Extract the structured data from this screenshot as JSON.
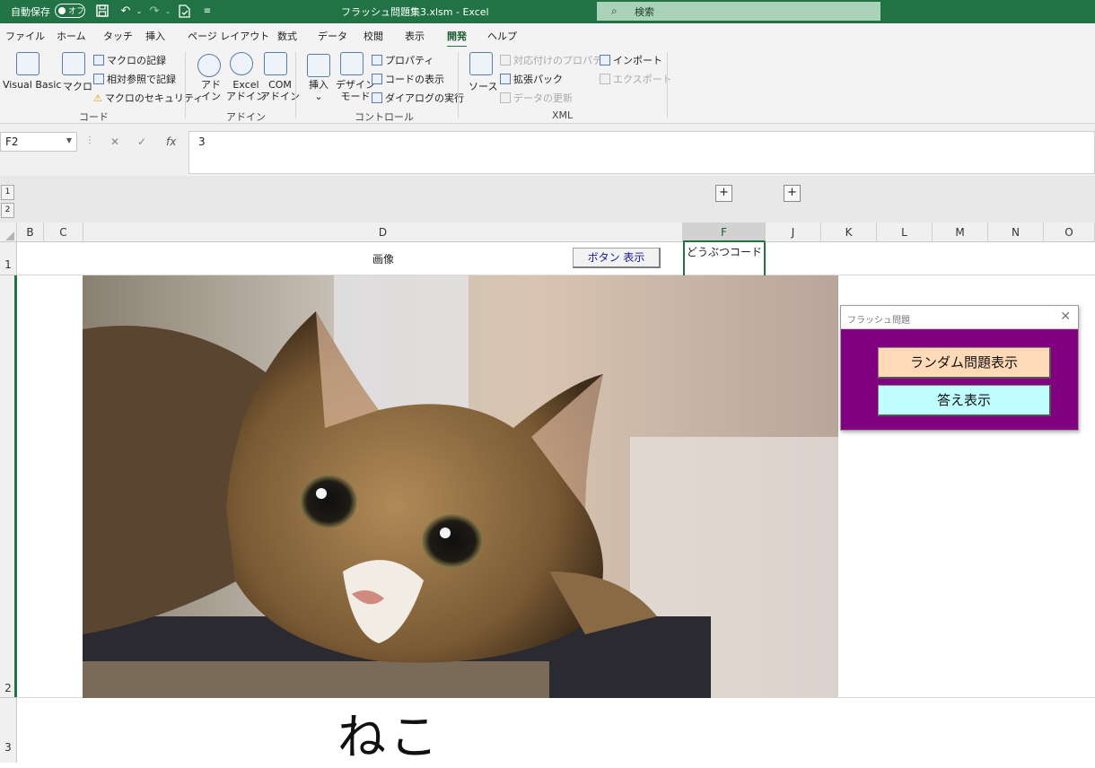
{
  "titlebar": {
    "autosave_label": "自動保存",
    "autosave_state": "オフ",
    "document_title": "フラッシュ問題集3.xlsm  -  Excel",
    "search_placeholder": "検索"
  },
  "menu": {
    "tabs": [
      "ファイル",
      "ホーム",
      "タッチ",
      "挿入",
      "ページ レイアウト",
      "数式",
      "データ",
      "校閲",
      "表示",
      "開発",
      "ヘルプ"
    ],
    "active_tab": "開発"
  },
  "ribbon": {
    "code": {
      "group_label": "コード",
      "visual_basic": "Visual Basic",
      "macro": "マクロ",
      "record_macro": "マクロの記録",
      "relative_ref": "相対参照で記録",
      "macro_security": "マクロのセキュリティ"
    },
    "addins": {
      "group_label": "アドイン",
      "addin_line1": "アド",
      "addin_line2": "イン",
      "excel_addin_line1": "Excel",
      "excel_addin_line2": "アドイン",
      "com_addin_line1": "COM",
      "com_addin_line2": "アドイン"
    },
    "controls": {
      "group_label": "コントロール",
      "insert": "挿入",
      "design_mode_line1": "デザイン",
      "design_mode_line2": "モード",
      "properties": "プロパティ",
      "view_code": "コードの表示",
      "run_dialog": "ダイアログの実行"
    },
    "xml": {
      "group_label": "XML",
      "source": "ソース",
      "map_properties": "対応付けのプロパティ",
      "expansion_packs": "拡張パック",
      "refresh_data": "データの更新",
      "import": "インポート",
      "export": "エクスポート"
    }
  },
  "formula_bar": {
    "name_box": "F2",
    "formula": "3"
  },
  "outline": {
    "levels": [
      "1",
      "2"
    ]
  },
  "columns": [
    "B",
    "C",
    "D",
    "F",
    "J",
    "K",
    "L",
    "M",
    "N",
    "O"
  ],
  "rows": [
    "1",
    "2",
    "3"
  ],
  "sheet": {
    "d1_header": "画像",
    "f1_header": "どうぶつコード",
    "button_label": "ボタン 表示",
    "answer_word": "ねこ"
  },
  "userform": {
    "title": "フラッシュ問題",
    "random_button": "ランダム問題表示",
    "answer_button": "答え表示",
    "background": "#800080",
    "random_button_color": "#FFDAB9",
    "answer_button_color": "#BFFFFF"
  },
  "colors": {
    "excel_green": "#217346"
  }
}
